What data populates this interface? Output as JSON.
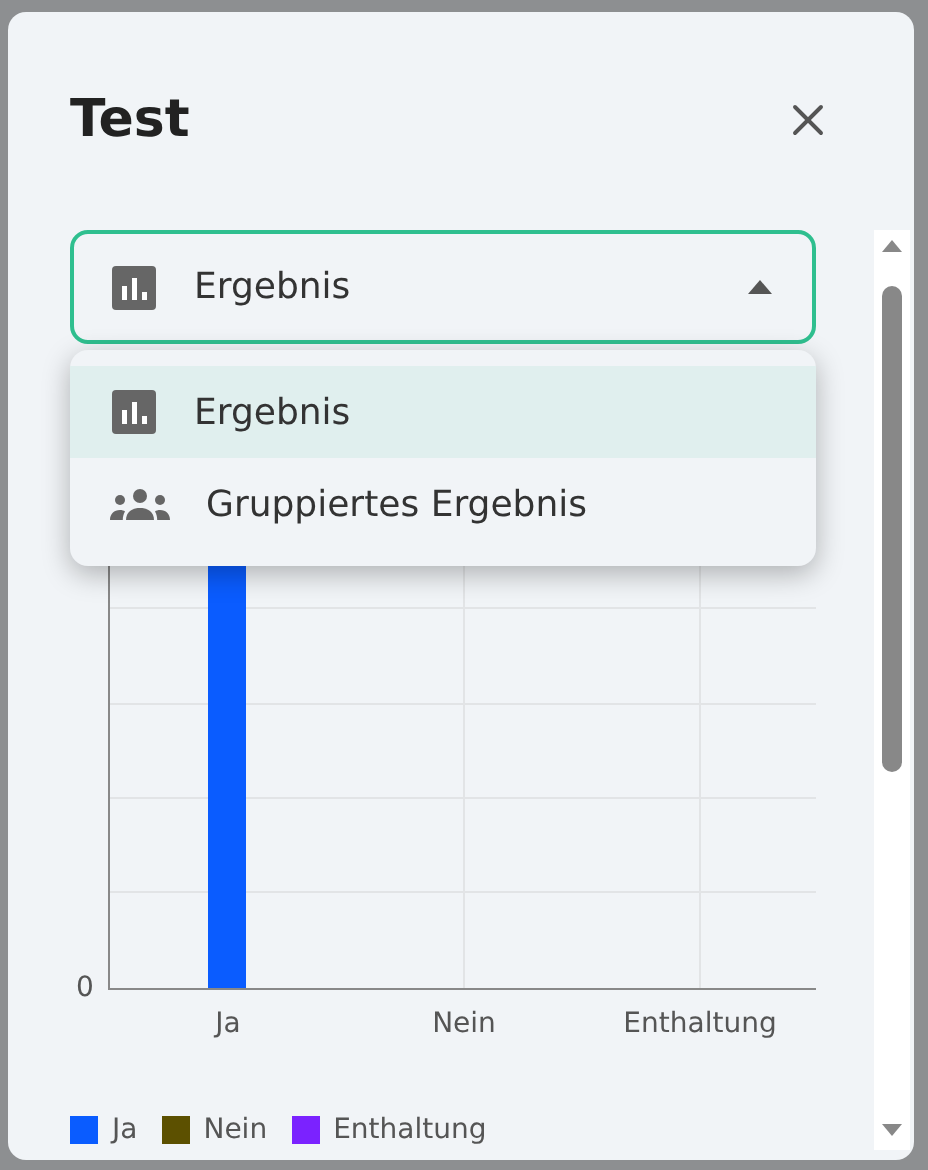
{
  "dialog": {
    "title": "Test"
  },
  "select": {
    "value": "Ergebnis",
    "kind": "chart",
    "expanded": true
  },
  "menu": [
    {
      "label": "Ergebnis",
      "kind": "chart",
      "selected": true
    },
    {
      "label": "Gruppiertes Ergebnis",
      "kind": "group",
      "selected": false
    }
  ],
  "chart": {
    "y_tick": "0",
    "categories": [
      "Ja",
      "Nein",
      "Enthaltung"
    ],
    "legend": [
      {
        "label": "Ja",
        "color": "#0a5cff"
      },
      {
        "label": "Nein",
        "color": "#5c5000"
      },
      {
        "label": "Enthaltung",
        "color": "#7b22ff"
      }
    ]
  }
}
